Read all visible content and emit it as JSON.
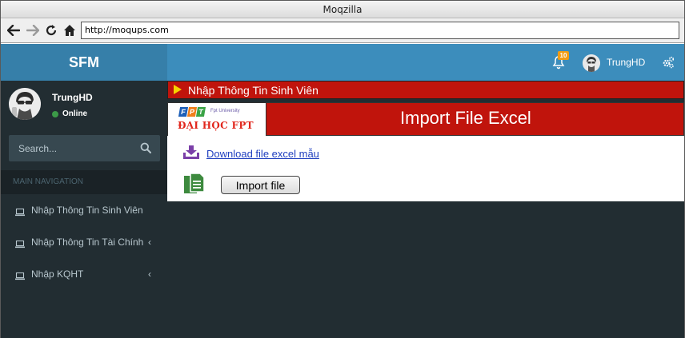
{
  "browser": {
    "title": "Moqzilla",
    "url": "http://moqups.com"
  },
  "app": {
    "logo": "SFM",
    "topbar": {
      "notification_count": "10",
      "user_name": "TrungHD"
    },
    "colors": {
      "header_dark": "#367fa9",
      "header": "#3c8dbc",
      "sidebar": "#222d32",
      "accent_red": "#c0140c",
      "status_green": "#3c9a48",
      "badge_orange": "#f39c12"
    }
  },
  "sidebar": {
    "user_name": "TrungHD",
    "status": "Online",
    "search_placeholder": "Search...",
    "nav_header": "MAIN NAVIGATION",
    "items": [
      {
        "label": "Nhập Thông Tin Sinh Viên",
        "icon": "laptop-icon",
        "has_submenu": false
      },
      {
        "label": "Nhập Thông Tin Tài Chính",
        "icon": "laptop-icon",
        "has_submenu": true
      },
      {
        "label": "Nhập KQHT",
        "icon": "laptop-icon",
        "has_submenu": true
      }
    ]
  },
  "content": {
    "section_title": "Nhập Thông Tin Sinh Viên",
    "logo": {
      "letters": [
        "F",
        "P",
        "T"
      ],
      "subtitle": "Fpt University",
      "name": "ĐẠI HỌC FPT"
    },
    "panel_title": "Import File Excel",
    "download_link": "Download file excel mẫu",
    "import_button": "Import file"
  }
}
